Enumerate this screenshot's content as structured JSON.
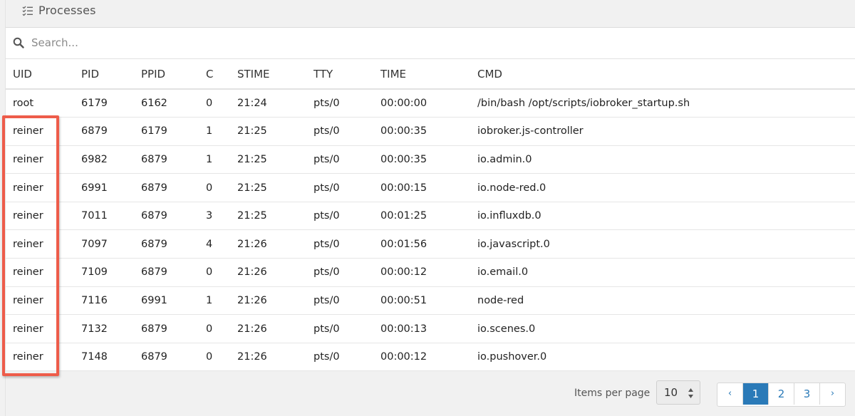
{
  "panel": {
    "title": "Processes",
    "title_icon": "list-check-icon"
  },
  "search": {
    "placeholder": "Search...",
    "value": ""
  },
  "table": {
    "columns": [
      "UID",
      "PID",
      "PPID",
      "C",
      "STIME",
      "TTY",
      "TIME",
      "CMD"
    ],
    "rows": [
      [
        "root",
        "6179",
        "6162",
        "0",
        "21:24",
        "pts/0",
        "00:00:00",
        "/bin/bash /opt/scripts/iobroker_startup.sh"
      ],
      [
        "reiner",
        "6879",
        "6179",
        "1",
        "21:25",
        "pts/0",
        "00:00:35",
        "iobroker.js-controller"
      ],
      [
        "reiner",
        "6982",
        "6879",
        "1",
        "21:25",
        "pts/0",
        "00:00:35",
        "io.admin.0"
      ],
      [
        "reiner",
        "6991",
        "6879",
        "0",
        "21:25",
        "pts/0",
        "00:00:15",
        "io.node-red.0"
      ],
      [
        "reiner",
        "7011",
        "6879",
        "3",
        "21:25",
        "pts/0",
        "00:01:25",
        "io.influxdb.0"
      ],
      [
        "reiner",
        "7097",
        "6879",
        "4",
        "21:26",
        "pts/0",
        "00:01:56",
        "io.javascript.0"
      ],
      [
        "reiner",
        "7109",
        "6879",
        "0",
        "21:26",
        "pts/0",
        "00:00:12",
        "io.email.0"
      ],
      [
        "reiner",
        "7116",
        "6991",
        "1",
        "21:26",
        "pts/0",
        "00:00:51",
        "node-red"
      ],
      [
        "reiner",
        "7132",
        "6879",
        "0",
        "21:26",
        "pts/0",
        "00:00:13",
        "io.scenes.0"
      ],
      [
        "reiner",
        "7148",
        "6879",
        "0",
        "21:26",
        "pts/0",
        "00:00:12",
        "io.pushover.0"
      ]
    ]
  },
  "footer": {
    "items_per_page_label": "Items per page",
    "items_per_page_value": "10",
    "pages": [
      {
        "label": "‹",
        "kind": "prev"
      },
      {
        "label": "1",
        "kind": "page",
        "active": true
      },
      {
        "label": "2",
        "kind": "page"
      },
      {
        "label": "3",
        "kind": "page"
      },
      {
        "label": "›",
        "kind": "next"
      }
    ]
  },
  "colors": {
    "accent": "#2a7ab8",
    "highlight_annotation": "#ee5c4a"
  }
}
